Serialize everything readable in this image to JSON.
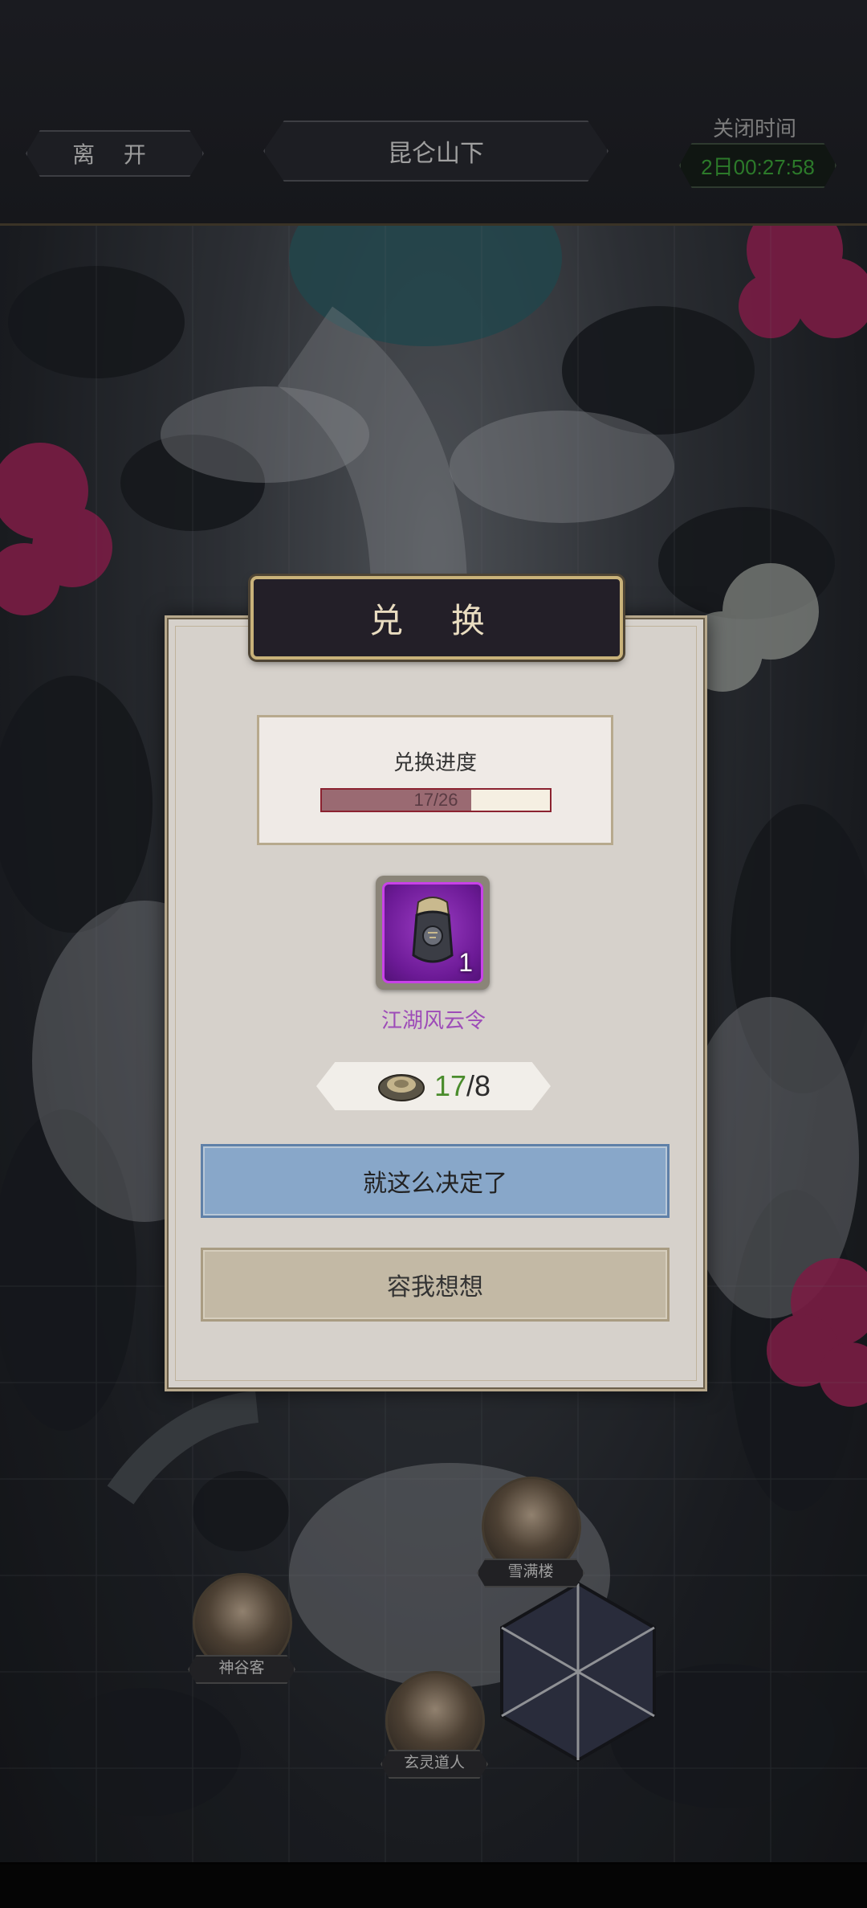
{
  "topbar": {
    "leave_label": "离 开",
    "location": "昆仑山下",
    "close_time_label": "关闭时间",
    "close_time_value": "2日00:27:58"
  },
  "dialog": {
    "title": "兑 换",
    "progress_label": "兑换进度",
    "progress": {
      "current": 17,
      "total": 26,
      "text": "17/26"
    },
    "item": {
      "name": "江湖风云令",
      "count": "1",
      "rarity_color": "#9b3cc3"
    },
    "cost": {
      "have": "17",
      "sep": "/",
      "need": "8",
      "icon": "silver-ingot-icon"
    },
    "confirm_label": "就这么决定了",
    "cancel_label": "容我想想"
  },
  "npcs": [
    {
      "name": "雪满楼"
    },
    {
      "name": "神谷客"
    },
    {
      "name": "玄灵道人"
    }
  ],
  "colors": {
    "confirm_button": "#88a7c9",
    "cancel_button": "#c3b9a5",
    "timer_text": "#2c7a2a",
    "item_name": "#9d4cb8"
  }
}
